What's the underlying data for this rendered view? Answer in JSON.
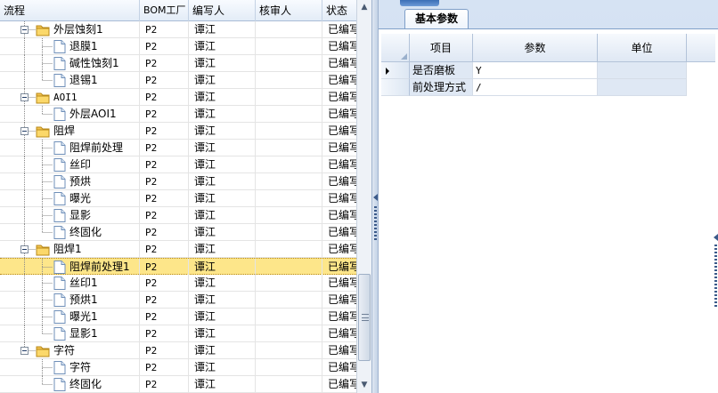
{
  "tree": {
    "columns": [
      "流程",
      "BOM工厂",
      "编写人",
      "核审人",
      "状态"
    ],
    "rows": [
      {
        "label": "外层蚀刻1",
        "type": "folder",
        "bom": "P2",
        "writer": "谭江",
        "reviewer": "",
        "status": "已编写"
      },
      {
        "label": "退膜1",
        "type": "file",
        "bom": "P2",
        "writer": "谭江",
        "reviewer": "",
        "status": "已编写"
      },
      {
        "label": "碱性蚀刻1",
        "type": "file",
        "bom": "P2",
        "writer": "谭江",
        "reviewer": "",
        "status": "已编写"
      },
      {
        "label": "退锡1",
        "type": "file",
        "bom": "P2",
        "writer": "谭江",
        "reviewer": "",
        "status": "已编写"
      },
      {
        "label": "AOI1",
        "type": "folder",
        "bom": "P2",
        "writer": "谭江",
        "reviewer": "",
        "status": "已编写"
      },
      {
        "label": "外层AOI1",
        "type": "file",
        "bom": "P2",
        "writer": "谭江",
        "reviewer": "",
        "status": "已编写"
      },
      {
        "label": "阻焊",
        "type": "folder",
        "bom": "P2",
        "writer": "谭江",
        "reviewer": "",
        "status": "已编写"
      },
      {
        "label": "阻焊前处理",
        "type": "file",
        "bom": "P2",
        "writer": "谭江",
        "reviewer": "",
        "status": "已编写"
      },
      {
        "label": "丝印",
        "type": "file",
        "bom": "P2",
        "writer": "谭江",
        "reviewer": "",
        "status": "已编写"
      },
      {
        "label": "预烘",
        "type": "file",
        "bom": "P2",
        "writer": "谭江",
        "reviewer": "",
        "status": "已编写"
      },
      {
        "label": "曝光",
        "type": "file",
        "bom": "P2",
        "writer": "谭江",
        "reviewer": "",
        "status": "已编写"
      },
      {
        "label": "显影",
        "type": "file",
        "bom": "P2",
        "writer": "谭江",
        "reviewer": "",
        "status": "已编写"
      },
      {
        "label": "终固化",
        "type": "file",
        "bom": "P2",
        "writer": "谭江",
        "reviewer": "",
        "status": "已编写"
      },
      {
        "label": "阻焊1",
        "type": "folder",
        "bom": "P2",
        "writer": "谭江",
        "reviewer": "",
        "status": "已编写"
      },
      {
        "label": "阻焊前处理1",
        "type": "file",
        "bom": "P2",
        "writer": "谭江",
        "reviewer": "",
        "status": "已编写",
        "selected": true
      },
      {
        "label": "丝印1",
        "type": "file",
        "bom": "P2",
        "writer": "谭江",
        "reviewer": "",
        "status": "已编写"
      },
      {
        "label": "预烘1",
        "type": "file",
        "bom": "P2",
        "writer": "谭江",
        "reviewer": "",
        "status": "已编写"
      },
      {
        "label": "曝光1",
        "type": "file",
        "bom": "P2",
        "writer": "谭江",
        "reviewer": "",
        "status": "已编写"
      },
      {
        "label": "显影1",
        "type": "file",
        "bom": "P2",
        "writer": "谭江",
        "reviewer": "",
        "status": "已编写"
      },
      {
        "label": "字符",
        "type": "folder",
        "bom": "P2",
        "writer": "谭江",
        "reviewer": "",
        "status": "已编写"
      },
      {
        "label": "字符",
        "type": "file",
        "bom": "P2",
        "writer": "谭江",
        "reviewer": "",
        "status": "已编写"
      },
      {
        "label": "终固化",
        "type": "file",
        "bom": "P2",
        "writer": "谭江",
        "reviewer": "",
        "status": "已编写"
      }
    ]
  },
  "panel": {
    "tab_label": "基本参数",
    "columns": [
      "项目",
      "参数",
      "单位"
    ],
    "rows": [
      {
        "item": "是否磨板",
        "param": "Y",
        "unit": "",
        "current": true
      },
      {
        "item": "前处理方式",
        "param": "/",
        "unit": "",
        "current": false
      }
    ]
  },
  "colors": {
    "selected_row": "#fde68a",
    "folder": "#f2c24f",
    "header_blue": "#c9d9ee"
  },
  "icons": {
    "folder": "folder-icon",
    "file": "document-icon",
    "collapse": "minus-box-icon",
    "scroll_up": "arrow-up-icon",
    "scroll_down": "arrow-down-icon",
    "row_pointer": "row-pointer-icon"
  }
}
